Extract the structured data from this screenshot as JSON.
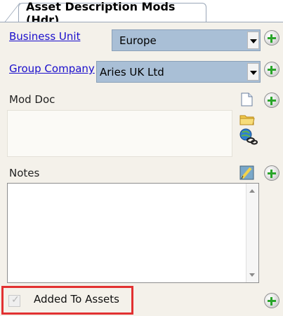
{
  "tab": {
    "title": "Asset Description Mods (Hdr)"
  },
  "business_unit": {
    "label": "Business Unit",
    "value": "Europe"
  },
  "group_company": {
    "label": "Group Company",
    "value": "Aries UK Ltd"
  },
  "mod_doc": {
    "label": "Mod Doc"
  },
  "notes": {
    "label": "Notes"
  },
  "added_to_assets": {
    "label": "Added To Assets",
    "checked": true
  },
  "colors": {
    "accent_plus": "#2aa52a",
    "highlight_border": "#e23131",
    "combo_bg": "#a9bfd6",
    "link": "#1a0ecc"
  },
  "icons": [
    "add-icon",
    "document-icon",
    "folder-icon",
    "globe-link-icon",
    "notes-edit-icon",
    "chevron-down-icon"
  ]
}
